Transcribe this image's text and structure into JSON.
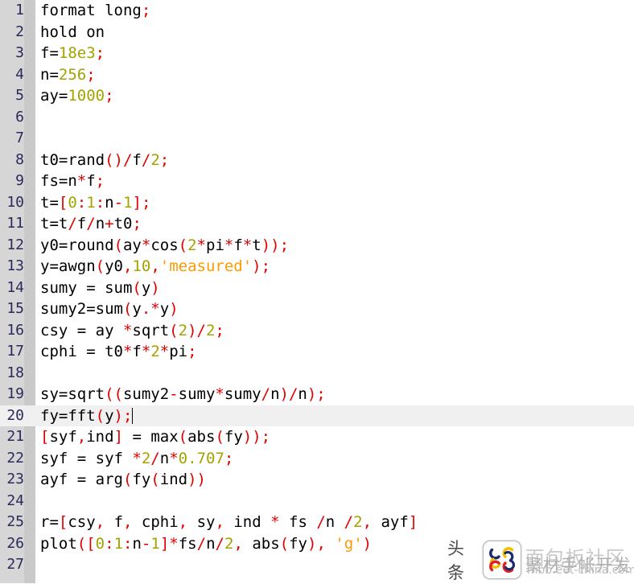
{
  "editor": {
    "language": "matlab",
    "current_line": 20,
    "total_lines": 27,
    "colors": {
      "background": "#ffffff",
      "gutter": "#d6d6d6",
      "line_number": "#2a2a5a",
      "current_line_highlight": "#f0f0f0",
      "plain": "#000000",
      "number": "#a3a300",
      "punctuation": "#e00000",
      "string": "#ff9900"
    }
  },
  "lines": [
    {
      "n": "1",
      "tokens": [
        {
          "t": "format long",
          "c": "plain"
        },
        {
          "t": ";",
          "c": "punct"
        }
      ]
    },
    {
      "n": "2",
      "tokens": [
        {
          "t": "hold on",
          "c": "plain"
        }
      ]
    },
    {
      "n": "3",
      "tokens": [
        {
          "t": "f=",
          "c": "plain"
        },
        {
          "t": "18e3",
          "c": "num"
        },
        {
          "t": ";",
          "c": "punct"
        }
      ]
    },
    {
      "n": "4",
      "tokens": [
        {
          "t": "n=",
          "c": "plain"
        },
        {
          "t": "256",
          "c": "num"
        },
        {
          "t": ";",
          "c": "punct"
        }
      ]
    },
    {
      "n": "5",
      "tokens": [
        {
          "t": "ay=",
          "c": "plain"
        },
        {
          "t": "1000",
          "c": "num"
        },
        {
          "t": ";",
          "c": "punct"
        }
      ]
    },
    {
      "n": "6",
      "tokens": []
    },
    {
      "n": "7",
      "tokens": []
    },
    {
      "n": "8",
      "tokens": [
        {
          "t": "t0=rand",
          "c": "plain"
        },
        {
          "t": "()/",
          "c": "punct"
        },
        {
          "t": "f",
          "c": "plain"
        },
        {
          "t": "/",
          "c": "punct"
        },
        {
          "t": "2",
          "c": "num"
        },
        {
          "t": ";",
          "c": "punct"
        }
      ]
    },
    {
      "n": "9",
      "tokens": [
        {
          "t": "fs=n",
          "c": "plain"
        },
        {
          "t": "*",
          "c": "punct"
        },
        {
          "t": "f",
          "c": "plain"
        },
        {
          "t": ";",
          "c": "punct"
        }
      ]
    },
    {
      "n": "10",
      "tokens": [
        {
          "t": "t=",
          "c": "plain"
        },
        {
          "t": "[",
          "c": "punct"
        },
        {
          "t": "0",
          "c": "num"
        },
        {
          "t": ":",
          "c": "punct"
        },
        {
          "t": "1",
          "c": "num"
        },
        {
          "t": ":",
          "c": "punct"
        },
        {
          "t": "n",
          "c": "plain"
        },
        {
          "t": "-",
          "c": "punct"
        },
        {
          "t": "1",
          "c": "num"
        },
        {
          "t": "]",
          "c": "punct"
        },
        {
          "t": ";",
          "c": "punct"
        }
      ]
    },
    {
      "n": "11",
      "tokens": [
        {
          "t": "t=t",
          "c": "plain"
        },
        {
          "t": "/",
          "c": "punct"
        },
        {
          "t": "f",
          "c": "plain"
        },
        {
          "t": "/",
          "c": "punct"
        },
        {
          "t": "n",
          "c": "plain"
        },
        {
          "t": "+",
          "c": "punct"
        },
        {
          "t": "t0",
          "c": "plain"
        },
        {
          "t": ";",
          "c": "punct"
        }
      ]
    },
    {
      "n": "12",
      "tokens": [
        {
          "t": "y0=round",
          "c": "plain"
        },
        {
          "t": "(",
          "c": "punct"
        },
        {
          "t": "ay",
          "c": "plain"
        },
        {
          "t": "*",
          "c": "punct"
        },
        {
          "t": "cos",
          "c": "plain"
        },
        {
          "t": "(",
          "c": "punct"
        },
        {
          "t": "2",
          "c": "num"
        },
        {
          "t": "*",
          "c": "punct"
        },
        {
          "t": "pi",
          "c": "plain"
        },
        {
          "t": "*",
          "c": "punct"
        },
        {
          "t": "f",
          "c": "plain"
        },
        {
          "t": "*",
          "c": "punct"
        },
        {
          "t": "t",
          "c": "plain"
        },
        {
          "t": "));",
          "c": "punct"
        }
      ]
    },
    {
      "n": "13",
      "tokens": [
        {
          "t": "y=awgn",
          "c": "plain"
        },
        {
          "t": "(",
          "c": "punct"
        },
        {
          "t": "y0",
          "c": "plain"
        },
        {
          "t": ",",
          "c": "punct"
        },
        {
          "t": "10",
          "c": "num"
        },
        {
          "t": ",",
          "c": "punct"
        },
        {
          "t": "'measured'",
          "c": "str"
        },
        {
          "t": ");",
          "c": "punct"
        }
      ]
    },
    {
      "n": "14",
      "tokens": [
        {
          "t": "sumy = sum",
          "c": "plain"
        },
        {
          "t": "(",
          "c": "punct"
        },
        {
          "t": "y",
          "c": "plain"
        },
        {
          "t": ")",
          "c": "punct"
        }
      ]
    },
    {
      "n": "15",
      "tokens": [
        {
          "t": "sumy2=sum",
          "c": "plain"
        },
        {
          "t": "(",
          "c": "punct"
        },
        {
          "t": "y",
          "c": "plain"
        },
        {
          "t": ".*",
          "c": "punct"
        },
        {
          "t": "y",
          "c": "plain"
        },
        {
          "t": ")",
          "c": "punct"
        }
      ]
    },
    {
      "n": "16",
      "tokens": [
        {
          "t": "csy = ay ",
          "c": "plain"
        },
        {
          "t": "*",
          "c": "punct"
        },
        {
          "t": "sqrt",
          "c": "plain"
        },
        {
          "t": "(",
          "c": "punct"
        },
        {
          "t": "2",
          "c": "num"
        },
        {
          "t": ")/",
          "c": "punct"
        },
        {
          "t": "2",
          "c": "num"
        },
        {
          "t": ";",
          "c": "punct"
        }
      ]
    },
    {
      "n": "17",
      "tokens": [
        {
          "t": "cphi = t0",
          "c": "plain"
        },
        {
          "t": "*",
          "c": "punct"
        },
        {
          "t": "f",
          "c": "plain"
        },
        {
          "t": "*",
          "c": "punct"
        },
        {
          "t": "2",
          "c": "num"
        },
        {
          "t": "*",
          "c": "punct"
        },
        {
          "t": "pi",
          "c": "plain"
        },
        {
          "t": ";",
          "c": "punct"
        }
      ]
    },
    {
      "n": "18",
      "tokens": []
    },
    {
      "n": "19",
      "tokens": [
        {
          "t": "sy=sqrt",
          "c": "plain"
        },
        {
          "t": "((",
          "c": "punct"
        },
        {
          "t": "sumy2",
          "c": "plain"
        },
        {
          "t": "-",
          "c": "punct"
        },
        {
          "t": "sumy",
          "c": "plain"
        },
        {
          "t": "*",
          "c": "punct"
        },
        {
          "t": "sumy",
          "c": "plain"
        },
        {
          "t": "/",
          "c": "punct"
        },
        {
          "t": "n",
          "c": "plain"
        },
        {
          "t": ")/",
          "c": "punct"
        },
        {
          "t": "n",
          "c": "plain"
        },
        {
          "t": ");",
          "c": "punct"
        }
      ]
    },
    {
      "n": "20",
      "tokens": [
        {
          "t": "fy=fft",
          "c": "plain"
        },
        {
          "t": "(",
          "c": "punct"
        },
        {
          "t": "y",
          "c": "plain"
        },
        {
          "t": ");",
          "c": "punct"
        }
      ],
      "current": true,
      "caret": true
    },
    {
      "n": "21",
      "tokens": [
        {
          "t": "[",
          "c": "punct"
        },
        {
          "t": "syf",
          "c": "plain"
        },
        {
          "t": ",",
          "c": "punct"
        },
        {
          "t": "ind",
          "c": "plain"
        },
        {
          "t": "]",
          "c": "punct"
        },
        {
          "t": " = max",
          "c": "plain"
        },
        {
          "t": "(",
          "c": "punct"
        },
        {
          "t": "abs",
          "c": "plain"
        },
        {
          "t": "(",
          "c": "punct"
        },
        {
          "t": "fy",
          "c": "plain"
        },
        {
          "t": "));",
          "c": "punct"
        }
      ]
    },
    {
      "n": "22",
      "tokens": [
        {
          "t": "syf = syf ",
          "c": "plain"
        },
        {
          "t": "*",
          "c": "punct"
        },
        {
          "t": "2",
          "c": "num"
        },
        {
          "t": "/",
          "c": "punct"
        },
        {
          "t": "n",
          "c": "plain"
        },
        {
          "t": "*",
          "c": "punct"
        },
        {
          "t": "0.707",
          "c": "num"
        },
        {
          "t": ";",
          "c": "punct"
        }
      ]
    },
    {
      "n": "23",
      "tokens": [
        {
          "t": "ayf = arg",
          "c": "plain"
        },
        {
          "t": "(",
          "c": "punct"
        },
        {
          "t": "fy",
          "c": "plain"
        },
        {
          "t": "(",
          "c": "punct"
        },
        {
          "t": "ind",
          "c": "plain"
        },
        {
          "t": "))",
          "c": "punct"
        }
      ]
    },
    {
      "n": "24",
      "tokens": []
    },
    {
      "n": "25",
      "tokens": [
        {
          "t": "r=",
          "c": "plain"
        },
        {
          "t": "[",
          "c": "punct"
        },
        {
          "t": "csy",
          "c": "plain"
        },
        {
          "t": ",",
          "c": "punct"
        },
        {
          "t": " f",
          "c": "plain"
        },
        {
          "t": ",",
          "c": "punct"
        },
        {
          "t": " cphi",
          "c": "plain"
        },
        {
          "t": ",",
          "c": "punct"
        },
        {
          "t": " sy",
          "c": "plain"
        },
        {
          "t": ",",
          "c": "punct"
        },
        {
          "t": " ind ",
          "c": "plain"
        },
        {
          "t": "*",
          "c": "punct"
        },
        {
          "t": " fs ",
          "c": "plain"
        },
        {
          "t": "/",
          "c": "punct"
        },
        {
          "t": "n ",
          "c": "plain"
        },
        {
          "t": "/",
          "c": "punct"
        },
        {
          "t": "2",
          "c": "num"
        },
        {
          "t": ",",
          "c": "punct"
        },
        {
          "t": " ayf",
          "c": "plain"
        },
        {
          "t": "]",
          "c": "punct"
        }
      ]
    },
    {
      "n": "26",
      "tokens": [
        {
          "t": "plot",
          "c": "plain"
        },
        {
          "t": "([",
          "c": "punct"
        },
        {
          "t": "0",
          "c": "num"
        },
        {
          "t": ":",
          "c": "punct"
        },
        {
          "t": "1",
          "c": "num"
        },
        {
          "t": ":",
          "c": "punct"
        },
        {
          "t": "n",
          "c": "plain"
        },
        {
          "t": "-",
          "c": "punct"
        },
        {
          "t": "1",
          "c": "num"
        },
        {
          "t": "]",
          "c": "punct"
        },
        {
          "t": "*",
          "c": "punct"
        },
        {
          "t": "fs",
          "c": "plain"
        },
        {
          "t": "/",
          "c": "punct"
        },
        {
          "t": "n",
          "c": "plain"
        },
        {
          "t": "/",
          "c": "punct"
        },
        {
          "t": "2",
          "c": "num"
        },
        {
          "t": ",",
          "c": "punct"
        },
        {
          "t": " abs",
          "c": "plain"
        },
        {
          "t": "(",
          "c": "punct"
        },
        {
          "t": "fy",
          "c": "plain"
        },
        {
          "t": "),",
          "c": "punct"
        },
        {
          "t": " ",
          "c": "plain"
        },
        {
          "t": "'g'",
          "c": "str"
        },
        {
          "t": ")",
          "c": "punct"
        }
      ]
    },
    {
      "n": "27",
      "tokens": []
    }
  ],
  "watermark": {
    "toutiao_label": "头条",
    "site_name": "面包板社区",
    "site_name_overlay": "聚材手帐开发",
    "url": "mbb.eet-china.com",
    "logo_colors": [
      "#e02020",
      "#f0c000",
      "#1a2a6c"
    ]
  }
}
